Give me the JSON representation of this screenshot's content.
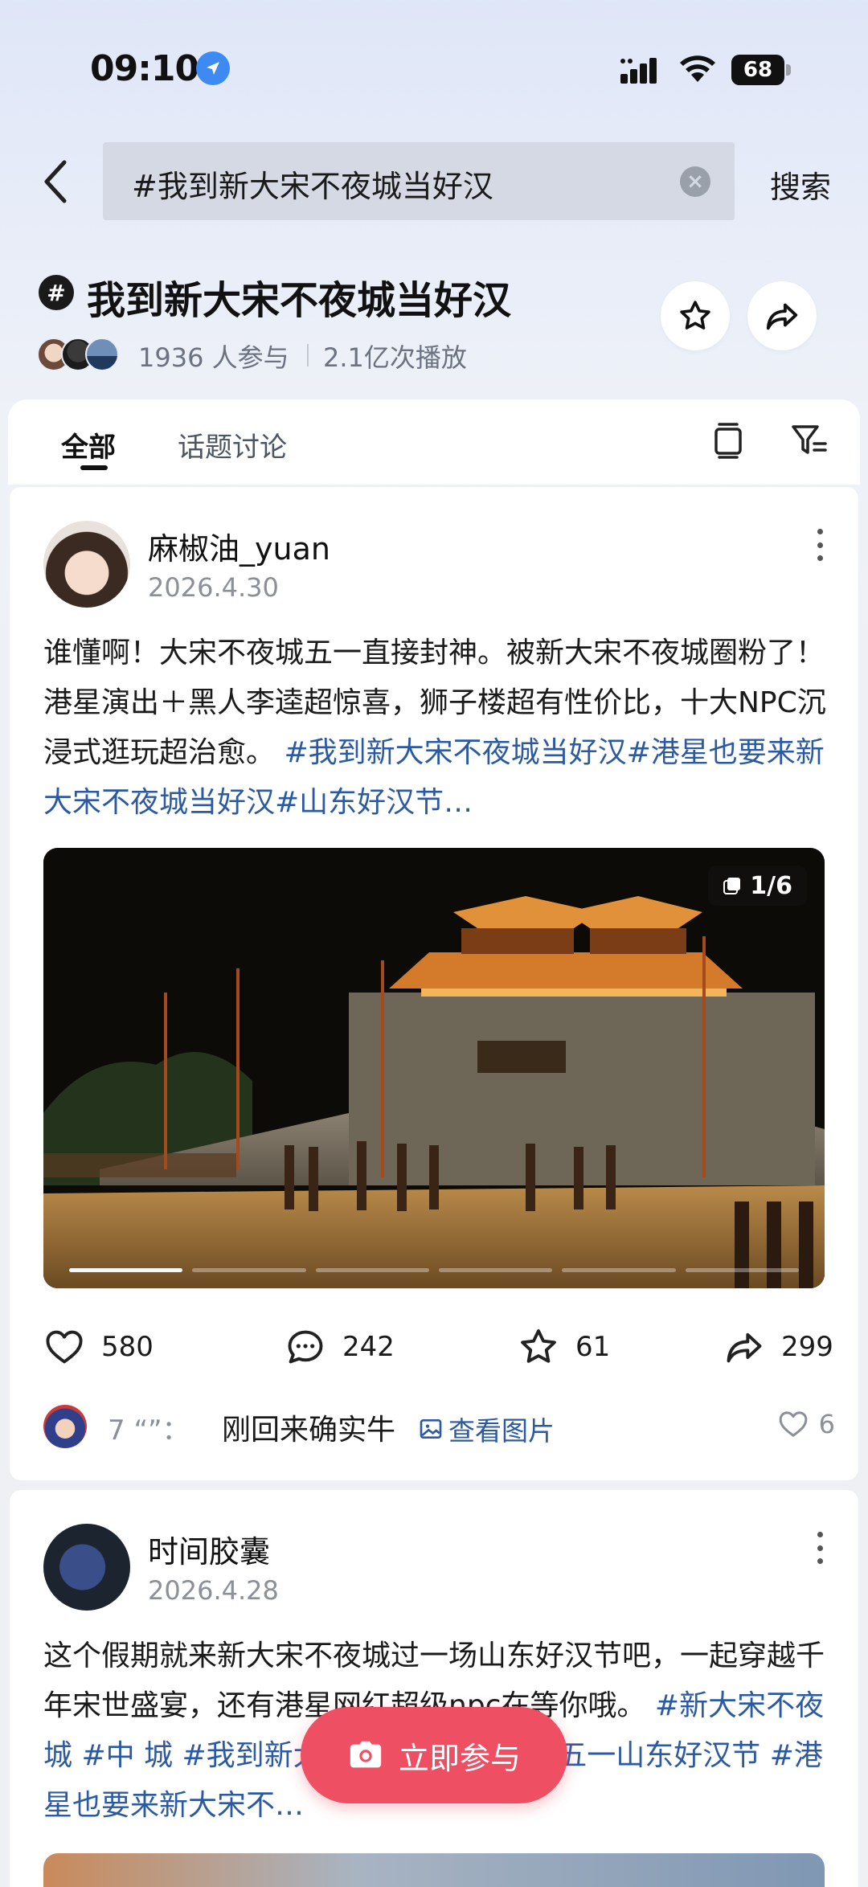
{
  "status_bar": {
    "time": "09:10",
    "battery": "68"
  },
  "search": {
    "query": "#我到新大宋不夜城当好汉",
    "button_label": "搜索"
  },
  "topic": {
    "hash_symbol": "#",
    "title": "我到新大宋不夜城当好汉",
    "participants": "1936 人参与",
    "plays": "2.1亿次播放"
  },
  "tabs": [
    {
      "label": "全部",
      "active": true
    },
    {
      "label": "话题讨论",
      "active": false
    }
  ],
  "posts": [
    {
      "author": "麻椒油_yuan",
      "date": "2026.4.30",
      "text": "谁懂啊！大宋不夜城五一直接封神。被新大宋不夜城圈粉了！港星演出＋黑人李逵超惊喜，狮子楼超有性价比，十大NPC沉浸式逛玩超治愈。",
      "hashtags": "#我到新大宋不夜城当好汉#港星也要来新大宋不夜城当好汉#山东好汉节…",
      "image_counter": "1/6",
      "image_count": 6,
      "image_current": 1,
      "likes": "580",
      "comments": "242",
      "favorites": "61",
      "shares": "299",
      "top_comment": {
        "user": "7 “”：",
        "text": "刚回来确实牛",
        "view_label": "查看图片",
        "likes": "6"
      }
    },
    {
      "author": "时间胶囊",
      "date": "2026.4.28",
      "text": "这个假期就来新大宋不夜城过一场山东好汉节吧，一起穿越千年宋世盛宴，还有港星网红超级npc在等你哦。",
      "hashtags": "#新大宋不夜城 #中          城 #我到新大宋不夜城当好汉 #五一山东好汉节 #港星也要来新大宋不…"
    }
  ],
  "join_button": {
    "label": "立即参与"
  },
  "colors": {
    "accent": "#ef4f62",
    "hashtag": "#2c5aa0",
    "background": "#eef0f4"
  }
}
